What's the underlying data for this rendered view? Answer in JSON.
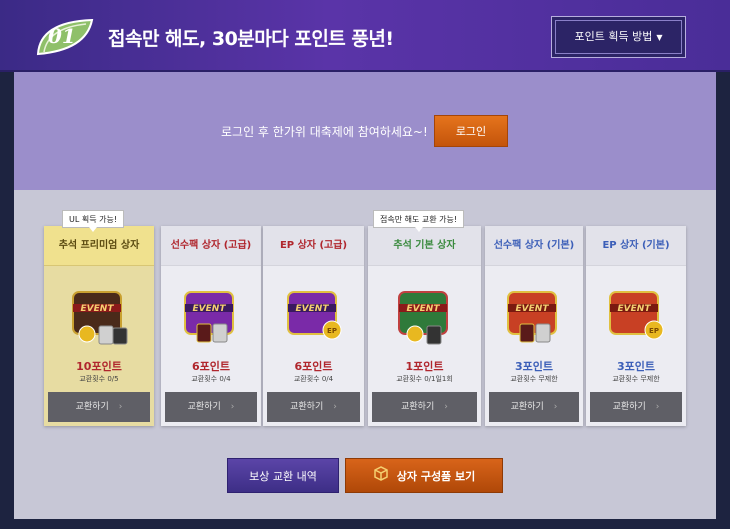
{
  "header": {
    "badge_number": "01",
    "title": "접속만 해도, 30분마다 포인트 풍년!",
    "howto_label": "포인트 획득 방법",
    "howto_caret": "▼"
  },
  "login": {
    "message": "로그인 후 한가위 대축제에 참여하세요~!",
    "button_label": "로그인"
  },
  "tooltips": {
    "ul": "UL 획득 가능!",
    "connect": "접속만 해도 교환 가능!"
  },
  "cards": [
    {
      "title": "추석 프리미엄 상자",
      "points": "10포인트",
      "limit": "교환횟수 0/5",
      "button": "교환하기",
      "box_color": "#4a2a1a",
      "accent": "#c9a030"
    },
    {
      "title": "선수팩 상자 (고급)",
      "points": "6포인트",
      "limit": "교환횟수 0/4",
      "button": "교환하기",
      "box_color": "#7a2aa8",
      "accent": "#e0c040"
    },
    {
      "title": "EP 상자 (고급)",
      "points": "6포인트",
      "limit": "교환횟수 0/4",
      "button": "교환하기",
      "box_color": "#7a2aa8",
      "accent": "#e0c040"
    },
    {
      "title": "추석 기본 상자",
      "points": "1포인트",
      "limit": "교환횟수 0/1일1회",
      "button": "교환하기",
      "box_color": "#2f7a3a",
      "accent": "#c04040"
    },
    {
      "title": "선수팩 상자 (기본)",
      "points": "3포인트",
      "limit": "교환횟수 무제한",
      "button": "교환하기",
      "box_color": "#c84024",
      "accent": "#e0c040"
    },
    {
      "title": "EP 상자 (기본)",
      "points": "3포인트",
      "limit": "교환횟수 무제한",
      "button": "교환하기",
      "box_color": "#c84024",
      "accent": "#e0c040"
    }
  ],
  "bottom": {
    "history_label": "보상 교환 내역",
    "contents_label": "상자 구성품 보기"
  }
}
